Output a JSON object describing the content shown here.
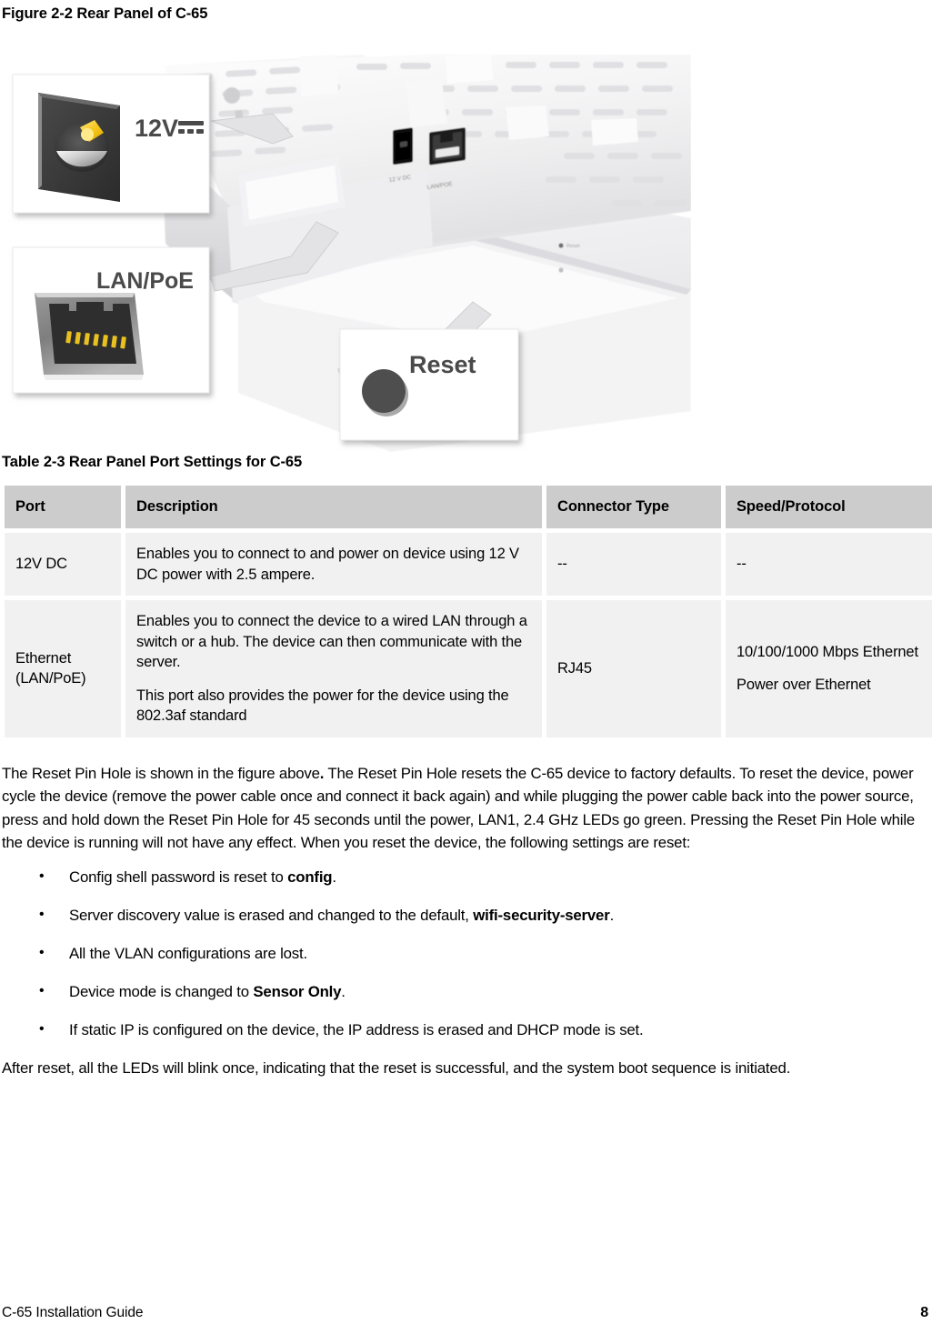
{
  "figure": {
    "caption": "Figure 2-2 Rear Panel of C-65",
    "callouts": [
      {
        "id": "power-callout",
        "label": "12V",
        "symbol": "DC-symbol"
      },
      {
        "id": "lan-callout",
        "label": "LAN/PoE"
      },
      {
        "id": "reset-callout",
        "label": "Reset"
      }
    ],
    "device_port_labels": [
      "12V DC",
      "LAN/POE",
      "Reset"
    ],
    "alt": "Photo of the C-65 rear panel showing the 12V DC jack, the LAN/PoE RJ45 port and the Reset pin hole, with three magnified callout boxes."
  },
  "table": {
    "caption": "Table 2-3 Rear Panel Port Settings for C-65",
    "headers": [
      "Port",
      "Description",
      "Connector Type",
      "Speed/Protocol"
    ],
    "rows": [
      {
        "port": "12V DC",
        "description": [
          "Enables you to connect to and power on device using 12 V DC power with 2.5 ampere."
        ],
        "connector": "--",
        "speed": [
          "--"
        ]
      },
      {
        "port": "Ethernet (LAN/PoE)",
        "description": [
          "Enables you to connect the device to a wired LAN through a switch or a hub. The device can then communicate with the server.",
          "This port also provides the power for the device using the 802.3af standard"
        ],
        "connector": "RJ45",
        "speed": [
          "10/100/1000 Mbps Ethernet",
          "Power over Ethernet"
        ]
      }
    ],
    "header_bg": "#cccccc",
    "cell_bg": "#f1f1f1"
  },
  "content": {
    "reset_paragraph_1": "The Reset Pin Hole is shown in the figure above",
    "reset_paragraph_1_bold_period": ".",
    "reset_paragraph_2": " The Reset Pin Hole resets the C-65 device to factory defaults. To reset the device, power cycle the device (remove the power cable once and connect it back again) and while plugging the power cable back into the power source, press and hold down the Reset Pin Hole for 45 seconds until the power, LAN1, 2.4 GHz LEDs go green. Pressing the Reset Pin Hole while the device is running will not have any effect. When you reset the device, the following settings are reset:",
    "bullets": [
      {
        "prefix": "Config shell password is reset to ",
        "bold": "config",
        "suffix": "."
      },
      {
        "prefix": "Server discovery value is erased and changed to the default, ",
        "bold": "wifi-security-server",
        "suffix": "."
      },
      {
        "prefix": "All the VLAN configurations are lost.",
        "bold": "",
        "suffix": ""
      },
      {
        "prefix": "Device mode is changed to ",
        "bold": "Sensor Only",
        "suffix": "."
      },
      {
        "prefix": "If static IP is configured on the device, the IP address is erased and DHCP mode is set.",
        "bold": "",
        "suffix": ""
      }
    ],
    "bullet_glyph": "•",
    "closing_paragraph": "After reset, all the LEDs will blink once, indicating that the reset is successful, and the system boot sequence is initiated."
  },
  "footer": {
    "doc_title": "C-65 Installation Guide",
    "page_number": "8"
  }
}
